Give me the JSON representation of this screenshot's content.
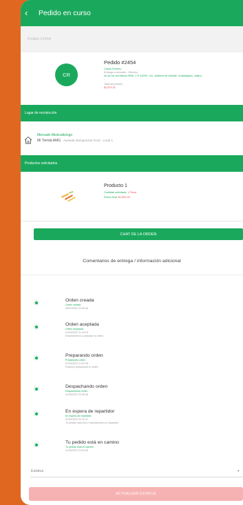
{
  "app_bar": {
    "title": "Pedido en curso",
    "back_icon": "chevron-left-icon"
  },
  "subheader": {
    "label": "Pedido #2454"
  },
  "order": {
    "avatar_initials": "CR",
    "title": "Pedido #2454",
    "customer": "Carlos Romero",
    "delivery": "Entrega a domicilio - Efectivo",
    "address": "Av de los científicos #590, C.P 44290, Col. Jardines de Alcalde, Guadalajara, Jalisco",
    "address_extra": "-",
    "total_label": "Total del pedido:",
    "total_value": "$1,879.31"
  },
  "pickup": {
    "header": "Lugar de recolección",
    "name": "Mercado Mexicaltzingo",
    "store": "Mi Tienda AMG",
    "address": "- Avenida Siempreviva #143 - Local 1",
    "icon": "home-icon"
  },
  "products": {
    "header": "Productos solicitados",
    "items": [
      {
        "name": "Producto 1",
        "qty_label": "Cantidad solicitada:",
        "qty_value": "1 Pieza",
        "price_label": "Precio final:",
        "price_value": "$1,600.00"
      }
    ]
  },
  "chat_button": "CHAT DE LA ORDEN",
  "comments_title": "Comentarios de entrega / información adicional",
  "timeline": [
    {
      "title": "Orden creada",
      "status": "Orden creada",
      "date": "26/01/2022 21:50:46",
      "note": ""
    },
    {
      "title": "Orden aceptada",
      "status": "Orden aceptada",
      "date": "01/04/2022 21:44:20",
      "note": "Empezaremos a preparar tu orden"
    },
    {
      "title": "Preparando orden",
      "status": "Preparando orden",
      "date": "01/04/2022 21:51:35",
      "note": "Estamos preparando tu orden"
    },
    {
      "title": "Despachando orden",
      "status": "Despachando orden",
      "date": "01/04/2022 22:05:46",
      "note": ""
    },
    {
      "title": "En espera de repartidor",
      "status": "En espera de repartidor",
      "date": "01/04/2022 22:10:47",
      "note": "Tu pedido esta listo y solicitaremos un repartidor"
    },
    {
      "title": "Tu pedido está en camino",
      "status": "Tu pedido está en camino",
      "date": "01/04/2022 23:03:35",
      "note": ""
    }
  ],
  "status_select": {
    "label": "Estatus",
    "caret": "▾"
  },
  "update_button": "ACTUALIZAR ESTATUS",
  "colors": {
    "brand_green": "#1aa95c",
    "frame_orange": "#e0671f",
    "price_red": "#e94c4c",
    "disabled_button": "#f6b2b2"
  }
}
